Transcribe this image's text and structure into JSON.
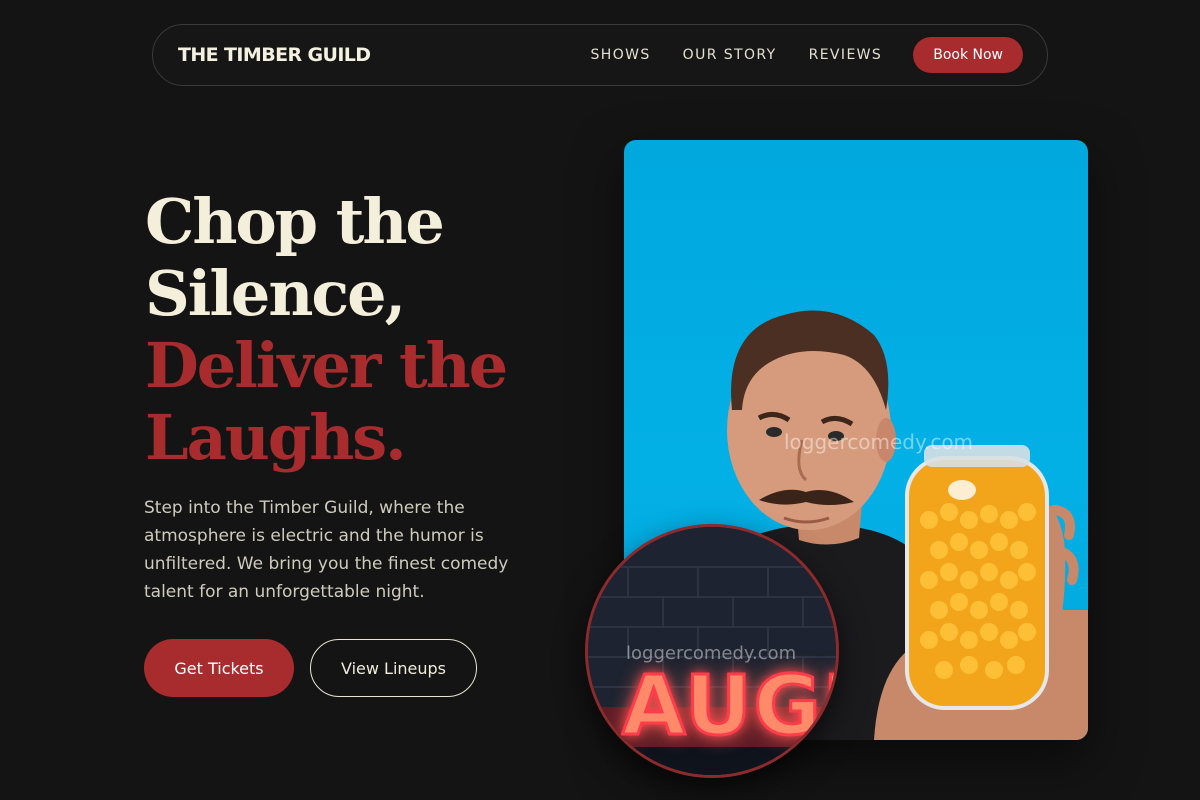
{
  "nav": {
    "brand": "THE TIMBER GUILD",
    "links": [
      "SHOWS",
      "OUR STORY",
      "REVIEWS"
    ],
    "cta": "Book Now"
  },
  "hero": {
    "headline_line1": "Chop the",
    "headline_line2": "Silence,",
    "headline_line3": "Deliver the",
    "headline_line4": "Laughs.",
    "description": "Step into the Timber Guild, where the atmosphere is electric and the humor is unfiltered. We bring you the finest comedy talent for an unforgettable night.",
    "primary_button": "Get Tickets",
    "secondary_button": "View Lineups"
  },
  "images": {
    "main_watermark": "loggercomedy.com",
    "circle_watermark": "loggercomedy.com",
    "neon_sign_text": "AUGI"
  },
  "colors": {
    "background": "#141414",
    "accent_red": "#a82c2e",
    "cream": "#f3efdb",
    "photo_blue": "#00a8de"
  }
}
